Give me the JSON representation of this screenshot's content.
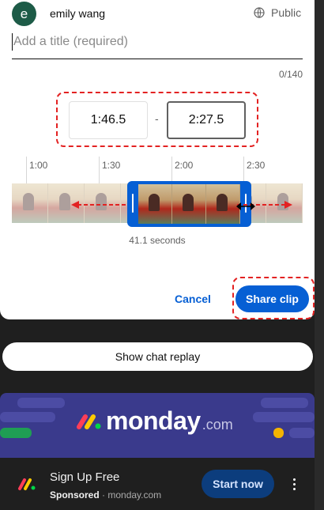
{
  "dialog": {
    "avatar_letter": "e",
    "user_name": "emily wang",
    "visibility": "Public",
    "title_placeholder": "Add a title (required)",
    "title_value": "",
    "char_count": "0/140",
    "start_time": "1:46.5",
    "end_time": "2:27.5",
    "time_separator": "-",
    "ticks": [
      "1:00",
      "1:30",
      "2:00",
      "2:30"
    ],
    "duration": "41.1 seconds",
    "cancel_label": "Cancel",
    "share_label": "Share clip"
  },
  "chat": {
    "show_replay_label": "Show chat replay"
  },
  "ad": {
    "brand_logo": "monday",
    "brand_tld": ".com",
    "title": "Sign Up Free",
    "sponsored": "Sponsored",
    "domain": "monday.com",
    "cta_label": "Start now"
  },
  "colors": {
    "accent": "#065fd4",
    "highlight": "#e32222",
    "avatar": "#1d5b47",
    "ad_background": "#3a3a8c"
  }
}
